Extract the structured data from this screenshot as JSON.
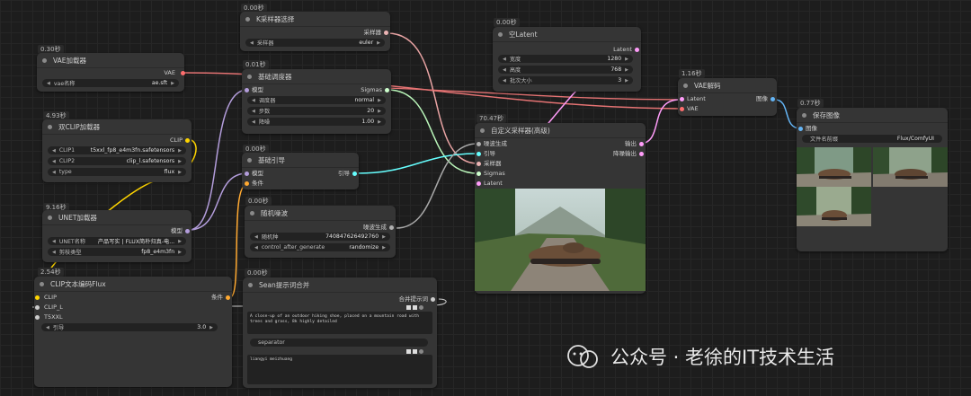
{
  "nodes": {
    "ksampler_select": {
      "time": "0.00秒",
      "title": "K采样器选择",
      "out": "采样器",
      "w_label": "采样器",
      "w_value": "euler"
    },
    "vae_loader": {
      "time": "0.30秒",
      "title": "VAE加载器",
      "out": "VAE",
      "w_label": "vae名称",
      "w_value": "ae.sft"
    },
    "scheduler": {
      "time": "0.01秒",
      "title": "基础调度器",
      "in": "模型",
      "out": "Sigmas",
      "w1_label": "调度器",
      "w1_value": "normal",
      "w2_label": "步数",
      "w2_value": "20",
      "w3_label": "降噪",
      "w3_value": "1.00"
    },
    "empty_latent": {
      "time": "0.00秒",
      "title": "空Latent",
      "out": "Latent",
      "w1_label": "宽度",
      "w1_value": "1280",
      "w2_label": "高度",
      "w2_value": "768",
      "w3_label": "批次大小",
      "w3_value": "3"
    },
    "vae_decode": {
      "time": "1.16秒",
      "title": "VAE解码",
      "in1": "Latent",
      "in2": "VAE",
      "out": "图像"
    },
    "dual_clip": {
      "time": "4.93秒",
      "title": "双CLIP加载器",
      "out": "CLIP",
      "w1_label": "CLIP1",
      "w1_value": "t5xxl_fp8_e4m3fn.safetensors",
      "w2_label": "CLIP2",
      "w2_value": "clip_l.safetensors",
      "w3_label": "type",
      "w3_value": "flux"
    },
    "guider": {
      "time": "0.00秒",
      "title": "基础引导",
      "in1": "模型",
      "in2": "条件",
      "out": "引导"
    },
    "custom_sampler": {
      "time": "70.47秒",
      "title": "自定义采样器(高级)",
      "in1": "噪波生成",
      "in2": "引导",
      "in3": "采样器",
      "in4": "Sigmas",
      "in5": "Latent",
      "out1": "输出",
      "out2": "降噪输出"
    },
    "save_image": {
      "time": "0.77秒",
      "title": "保存图像",
      "in": "图像",
      "w_label": "文件名前缀",
      "w_value": "Flux/ComfyUI"
    },
    "unet_loader": {
      "time": "9.16秒",
      "title": "UNET加载器",
      "out": "模型",
      "w1_label": "UNET名称",
      "w1_value": "产品写实 | FLUX简朴归真-电...",
      "w2_label": "剪枝类型",
      "w2_value": "fp8_e4m3fn"
    },
    "random_noise": {
      "time": "0.00秒",
      "title": "随机噪波",
      "out": "噪波生成",
      "w1_label": "随机种",
      "w1_value": "740847626492760",
      "w2_label": "control_after_generate",
      "w2_value": "randomize"
    },
    "clip_encode": {
      "time": "2.54秒",
      "title": "CLIP文本编码Flux",
      "in1": "CLIP",
      "in2": "CLIP_L",
      "in3": "T5XXL",
      "out": "条件",
      "w_label": "引导",
      "w_value": "3.0"
    },
    "prompt_concat": {
      "time": "0.00秒",
      "title": "Sean提示词合并",
      "out": "合并提示词",
      "text1": "A close-up of an outdoor hiking shoe, placed on a mountain road with trees and grass, 8k highly detailed",
      "separator": "separator",
      "text2": "liangyi meizhuang"
    }
  },
  "watermark": "公众号 · 老徐的IT技术生活",
  "colors": {
    "vae": "#ff6e6e",
    "model": "#b39ddb",
    "clip": "#ffd500",
    "cond": "#ffa931",
    "latent": "#ff9cf9",
    "sigmas": "#cdffcd",
    "sampler": "#ecb4b4",
    "guider": "#66ffff",
    "noise": "#b0b0b0",
    "image": "#64b5f6"
  }
}
